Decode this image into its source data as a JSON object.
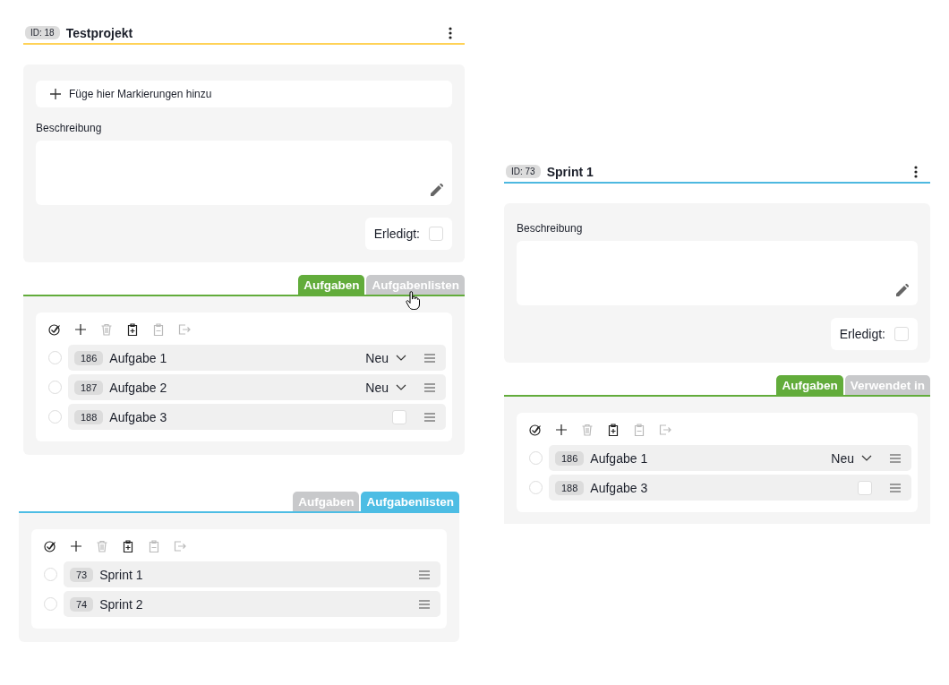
{
  "panels": [
    {
      "header": {
        "id_badge": "ID: 18",
        "title": "Testprojekt",
        "color": "#ffd257"
      },
      "details": {
        "tag_prompt": "Füge hier Markierungen hinzu",
        "description_label": "Beschreibung",
        "done_label": "Erledigt:",
        "done": false
      },
      "tabs": [
        {
          "label": "Aufgaben",
          "selected": true,
          "color": "#62ac3b"
        },
        {
          "label": "Aufgabenlisten",
          "selected": false
        }
      ],
      "toolbar": [
        {
          "kind": "check-all",
          "disabled": false
        },
        {
          "kind": "add",
          "disabled": false
        },
        {
          "kind": "delete",
          "disabled": true
        },
        {
          "kind": "paste",
          "disabled": false
        },
        {
          "kind": "remove",
          "disabled": true
        },
        {
          "kind": "export",
          "disabled": true
        }
      ],
      "items": [
        {
          "id": "186",
          "name": "Aufgabe 1",
          "kind": "status",
          "status": "Neu",
          "selected": false
        },
        {
          "id": "187",
          "name": "Aufgabe 2",
          "kind": "status",
          "status": "Neu",
          "selected": false
        },
        {
          "id": "188",
          "name": "Aufgabe 3",
          "kind": "checkbox",
          "checked": false,
          "selected": false
        }
      ]
    },
    {
      "tabs": [
        {
          "label": "Aufgaben",
          "selected": false
        },
        {
          "label": "Aufgabenlisten",
          "selected": true,
          "color": "#4dbde4"
        }
      ],
      "toolbar": [
        {
          "kind": "check-all",
          "disabled": false
        },
        {
          "kind": "add",
          "disabled": false
        },
        {
          "kind": "delete",
          "disabled": true
        },
        {
          "kind": "paste",
          "disabled": false
        },
        {
          "kind": "remove",
          "disabled": true
        },
        {
          "kind": "export",
          "disabled": true
        }
      ],
      "items": [
        {
          "id": "73",
          "name": "Sprint 1",
          "kind": "plain",
          "selected": false
        },
        {
          "id": "74",
          "name": "Sprint 2",
          "kind": "plain",
          "selected": false
        }
      ]
    },
    {
      "header": {
        "id_badge": "ID: 73",
        "title": "Sprint 1",
        "color": "#4db8e0"
      },
      "details": {
        "description_label": "Beschreibung",
        "done_label": "Erledigt:",
        "done": false
      },
      "tabs": [
        {
          "label": "Aufgaben",
          "selected": true,
          "color": "#62ac3b"
        },
        {
          "label": "Verwendet in",
          "selected": false
        }
      ],
      "toolbar": [
        {
          "kind": "check-all",
          "disabled": false
        },
        {
          "kind": "add",
          "disabled": false
        },
        {
          "kind": "delete",
          "disabled": true
        },
        {
          "kind": "paste",
          "disabled": false
        },
        {
          "kind": "remove",
          "disabled": true
        },
        {
          "kind": "export",
          "disabled": true
        }
      ],
      "items": [
        {
          "id": "186",
          "name": "Aufgabe 1",
          "kind": "status",
          "status": "Neu",
          "selected": false
        },
        {
          "id": "188",
          "name": "Aufgabe 3",
          "kind": "checkbox",
          "checked": false,
          "selected": false
        }
      ]
    }
  ]
}
